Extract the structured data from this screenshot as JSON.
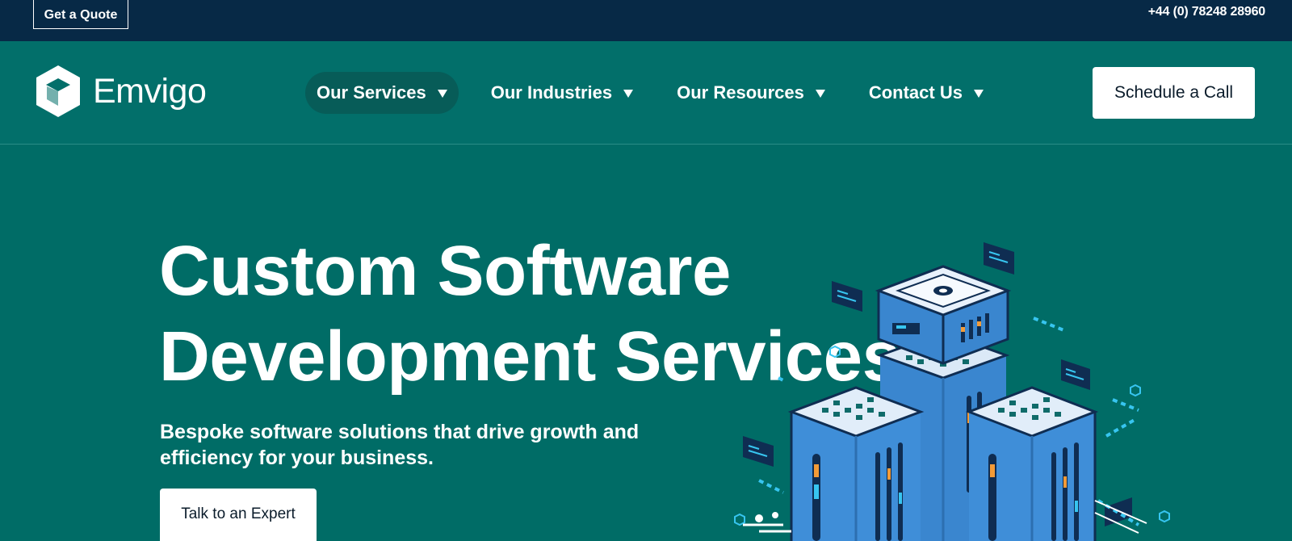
{
  "topbar": {
    "quote_label": "Get a Quote",
    "phone": "+44 (0) 78248 28960"
  },
  "brand": {
    "name": "Emvigo"
  },
  "nav": {
    "items": [
      {
        "label": "Our Services",
        "active": true
      },
      {
        "label": "Our Industries",
        "active": false
      },
      {
        "label": "Our Resources",
        "active": false
      },
      {
        "label": "Contact Us",
        "active": false
      }
    ],
    "cta_label": "Schedule a Call"
  },
  "hero": {
    "title_line1": "Custom Software",
    "title_line2": "Development Services",
    "subtitle_line1": "Bespoke software solutions that drive growth and",
    "subtitle_line2": "efficiency for your business.",
    "button_label": "Talk to an Expert"
  },
  "icons": {
    "logo": "hexagon-cube-logo",
    "nav_caret": "caret-down-icon",
    "illustration": "isometric-server-racks"
  },
  "colors": {
    "topbar_bg": "#072946",
    "nav_bg": "#026f6a",
    "hero_bg": "#006c66",
    "active_pill": "#075c58",
    "button_bg": "#ffffff",
    "server_blue": "#3f8ed8",
    "accent_orange": "#f29b38",
    "accent_cyan": "#37c5f0"
  }
}
